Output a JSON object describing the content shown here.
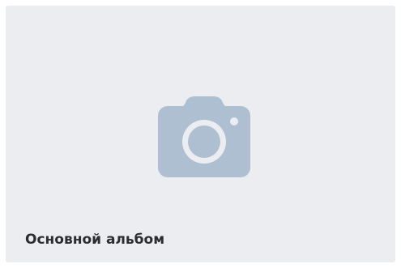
{
  "album": {
    "title": "Основной альбом",
    "cover_icon": "camera-icon",
    "has_cover_photo": false
  },
  "colors": {
    "card_background": "#ebedf1",
    "icon": "#aebfd1",
    "title_text": "#2c2d2e"
  }
}
